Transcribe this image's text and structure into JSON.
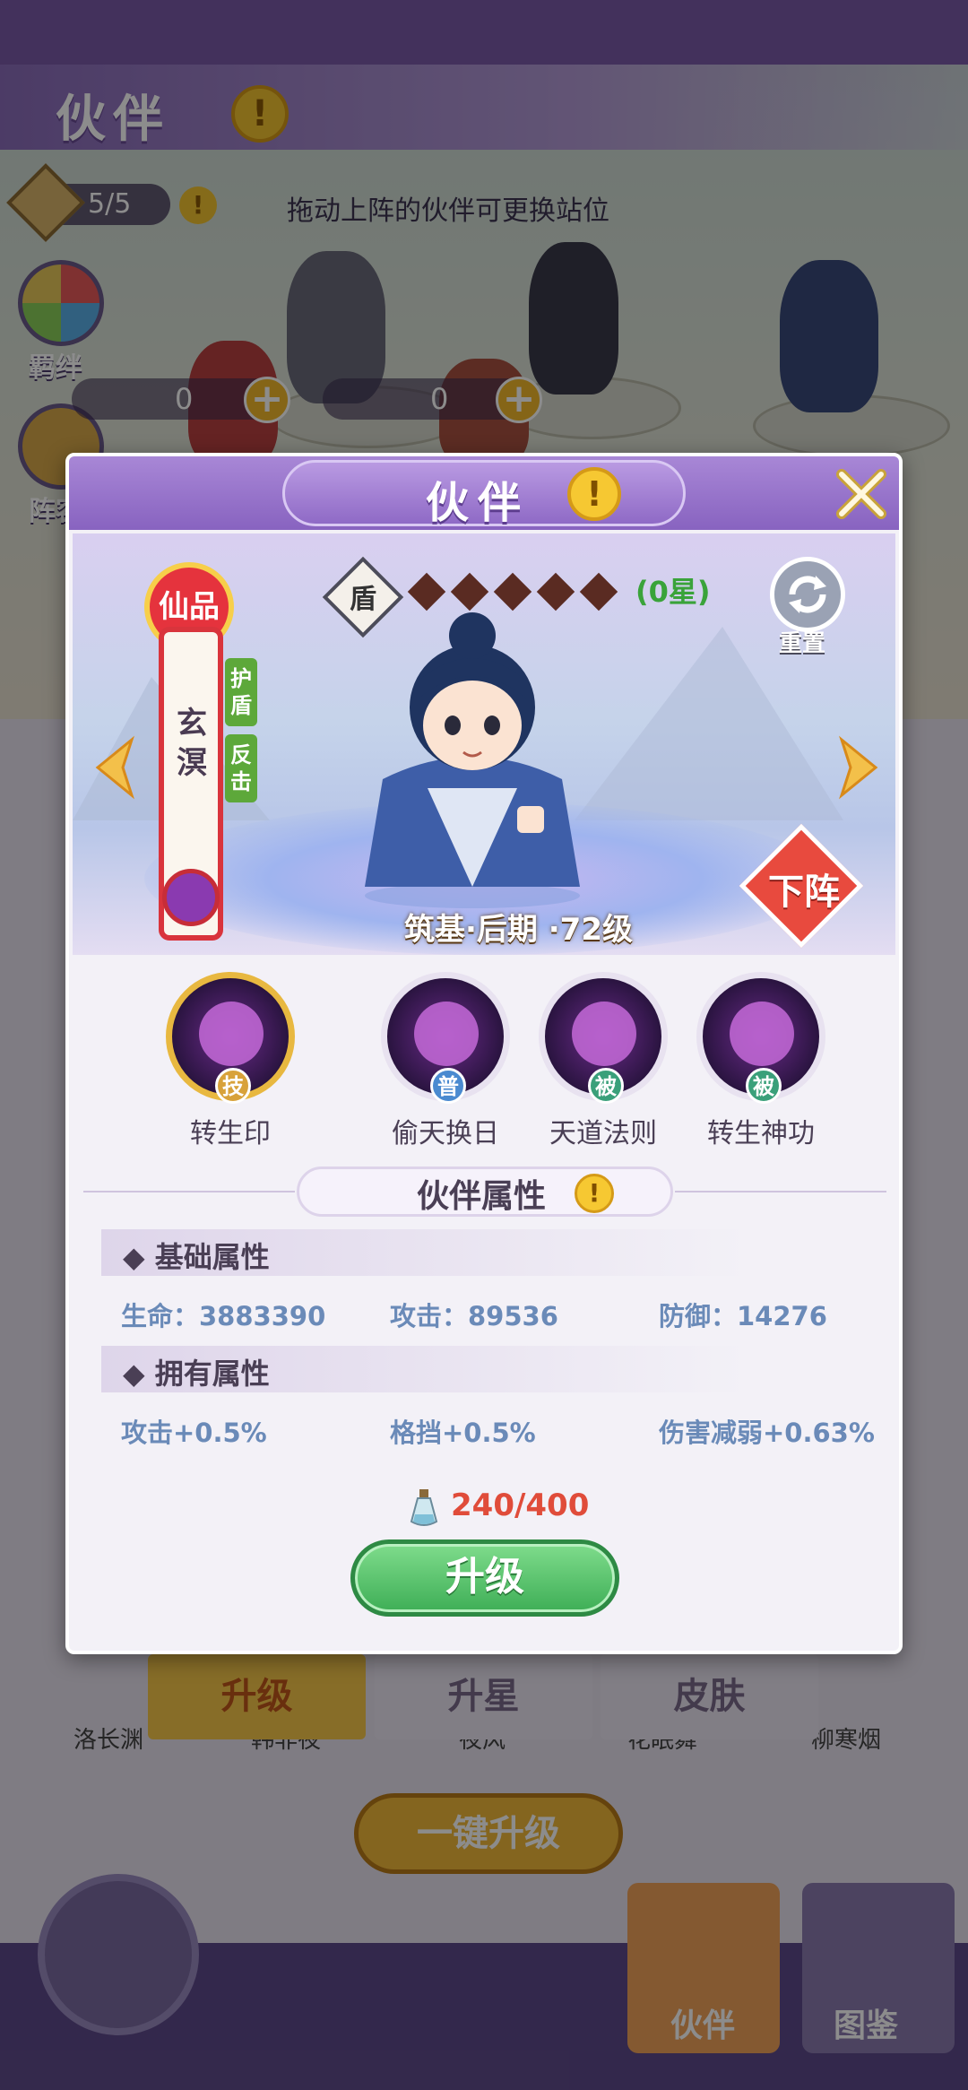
{
  "background": {
    "title": "伙伴",
    "formation_count": "5/5",
    "hint": "拖动上阵的伙伴可更换站位",
    "side_buttons": [
      "羁绊",
      "阵容"
    ],
    "resource_left": "0",
    "resource_right": "0",
    "partner_names": [
      "洛长渊",
      "韩非夜",
      "夜风",
      "花眠舞",
      "柳寒烟"
    ],
    "tabs": [
      "升级",
      "升星",
      "皮肤"
    ],
    "one_key_upgrade": "一键升级",
    "nav": [
      "伙伴",
      "图鉴"
    ]
  },
  "modal": {
    "title": "伙伴",
    "tip_icon": "!",
    "close_icon": "close-x",
    "hero": {
      "quality": "仙品",
      "name": "玄溟",
      "tags": [
        "护盾",
        "反击"
      ],
      "type": "盾",
      "stars_total": 5,
      "stars_lit": 0,
      "star_label": "(0星)",
      "reset_label": "重置",
      "level": "筑基·后期 ·72级",
      "down_label": "下阵"
    },
    "skills": [
      {
        "name": "转生印",
        "type": "技",
        "type_color": "#d8a23a"
      },
      {
        "name": "偷天换日",
        "type": "普",
        "type_color": "#4a8ad0"
      },
      {
        "name": "天道法则",
        "type": "被",
        "type_color": "#3aa07a"
      },
      {
        "name": "转生神功",
        "type": "被",
        "type_color": "#3aa07a"
      }
    ],
    "attributes_title": "伙伴属性",
    "basic": {
      "title": "基础属性",
      "items": [
        "生命：3883390",
        "攻击：89536",
        "防御：14276"
      ]
    },
    "owned": {
      "title": "拥有属性",
      "items": [
        "攻击+0.5%",
        "格挡+0.5%",
        "伤害减弱+0.63%"
      ]
    },
    "cost": "240/400",
    "upgrade_label": "升级"
  }
}
